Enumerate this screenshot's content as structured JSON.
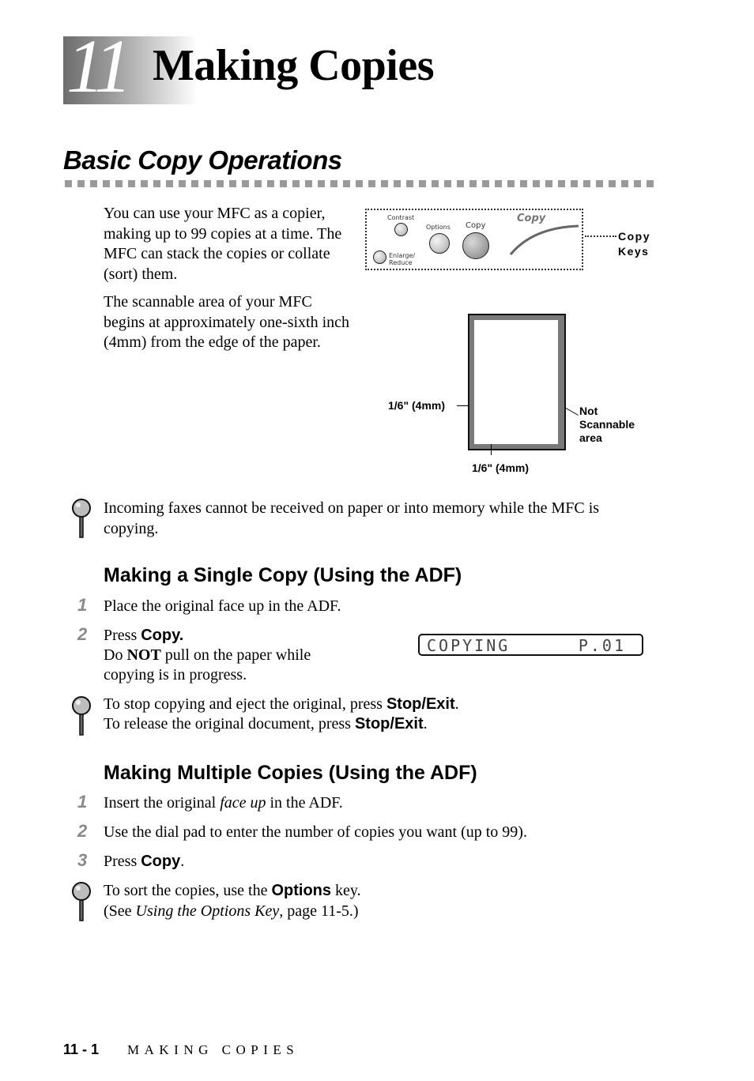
{
  "chapter": {
    "number": "11",
    "title": "Making Copies"
  },
  "section": {
    "title": "Basic Copy Operations"
  },
  "intro": {
    "paragraph1": "You can use your MFC as a copier, making up to 99 copies at a time. The MFC can stack the copies or collate (sort) them.",
    "paragraph2": "The scannable area of your MFC begins at approximately one-sixth inch (4mm) from the edge of the paper."
  },
  "copy_panel": {
    "keys": {
      "contrast": "Contrast",
      "options": "Options",
      "copy": "Copy",
      "enlarge_reduce_line1": "Enlarge/",
      "enlarge_reduce_line2": "Reduce"
    },
    "logo_text": "Copy",
    "callout_line1": "Copy",
    "callout_line2": "Keys"
  },
  "scan_diagram": {
    "left_margin_label": "1/6\" (4mm)",
    "bottom_margin_label": "1/6\" (4mm)",
    "not_scannable_line1": "Not",
    "not_scannable_line2": "Scannable",
    "not_scannable_line3": "area"
  },
  "note1": {
    "icon": "magnifier-icon",
    "text": "Incoming faxes cannot be received on paper or into memory while the MFC is copying."
  },
  "single_copy": {
    "heading": "Making a Single Copy (Using the ADF)",
    "steps": [
      {
        "num": "1",
        "text": "Place the original face up in the ADF."
      },
      {
        "num": "2",
        "prefix": "Press ",
        "key": "Copy.",
        "line2_pre": "Do ",
        "line2_bold": "NOT",
        "line2_post": " pull on the paper while",
        "line3": "copying is in progress."
      }
    ],
    "lcd_left": "COPYING",
    "lcd_right": "P.01"
  },
  "note2": {
    "icon": "magnifier-icon",
    "line1_pre": "To stop copying and eject the original, press ",
    "line1_key": "Stop/Exit",
    "line1_post": ".",
    "line2_pre": "To release the original document, press ",
    "line2_key": "Stop/Exit",
    "line2_post": "."
  },
  "multiple_copies": {
    "heading": "Making Multiple Copies (Using the ADF)",
    "steps": [
      {
        "num": "1",
        "pre": "Insert the original ",
        "italic": "face up",
        "post": " in the ADF."
      },
      {
        "num": "2",
        "text": "Use the dial pad to enter the number of copies you want (up to 99)."
      },
      {
        "num": "3",
        "pre": "Press ",
        "key": "Copy",
        "post": "."
      }
    ]
  },
  "note3": {
    "icon": "magnifier-icon",
    "line1_pre": "To sort the copies, use the ",
    "line1_key": "Options",
    "line1_post": " key.",
    "line2_pre": "(See ",
    "line2_italic": "Using the Options Key",
    "line2_post": ", page 11-5.)"
  },
  "footer": {
    "page": "11 - 1",
    "title": "MAKING COPIES"
  }
}
